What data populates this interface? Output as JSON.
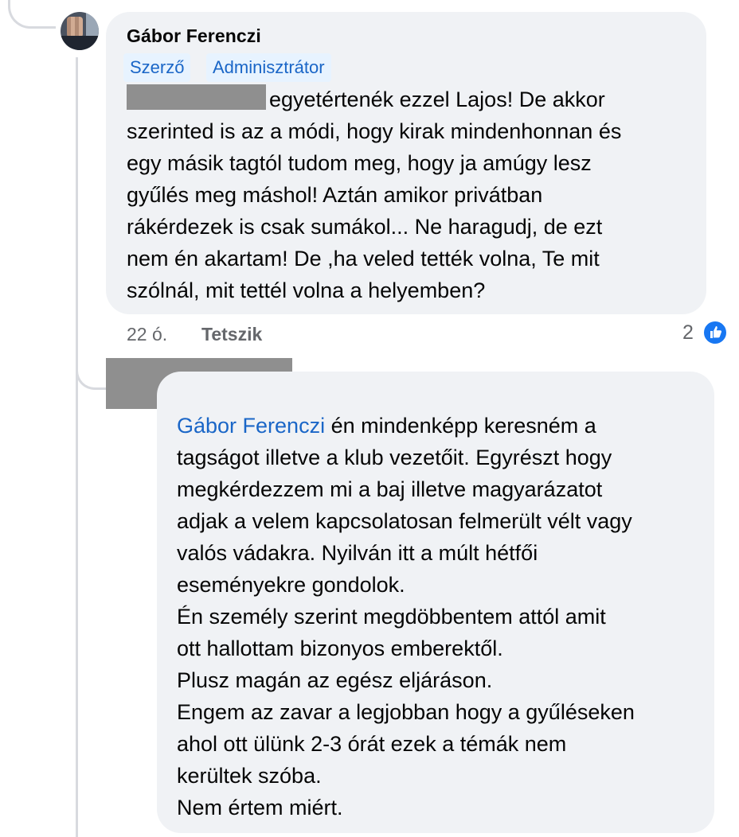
{
  "comment": {
    "author": "Gábor Ferenczi",
    "badges": [
      "Szerző",
      "Adminisztrátor"
    ],
    "text": "egyetértenék ezzel Lajos! De akkor\nszerinted is az a módi, hogy kirak mindenhonnan és\negy másik tagtól tudom meg, hogy ja amúgy lesz\ngyűlés meg máshol! Aztán amikor privátban\nrákérdezek is csak sumákol... Ne haragudj, de ezt\nnem én akartam! De ,ha veled tették volna, Te mit\nszólnál, mit tettél volna a helyemben?",
    "time": "22 ó.",
    "like_label": "Tetszik",
    "reaction_count": "2",
    "reaction_icon": "thumbs-up-icon"
  },
  "reply": {
    "mention": "Gábor Ferenczi",
    "first_line_rest": " én mindenképp keresném a",
    "lines": [
      "tagságot illetve a klub vezetőit. Egyrészt hogy",
      "megkérdezzem mi a baj illetve magyarázatot",
      "adjak a velem kapcsolatosan felmerült vélt vagy",
      "valós vádakra. Nyilván itt a múlt hétfői",
      "eseményekre gondolok.",
      "Én személy szerint megdöbbentem attól amit",
      "ott hallottam bizonyos emberektől.",
      "Plusz magán az egész eljáráson.",
      "Engem az zavar a legjobban hogy a gyűléseken",
      "ahol ott ülünk 2-3  órát ezek a témák nem",
      "kerültek szóba.",
      "Nem értem miért."
    ]
  },
  "colors": {
    "bubble": "#f0f2f5",
    "link": "#1a66c7",
    "badge_bg": "#e7f3ff",
    "like_blue": "#1877f2",
    "meta": "#65676b"
  }
}
